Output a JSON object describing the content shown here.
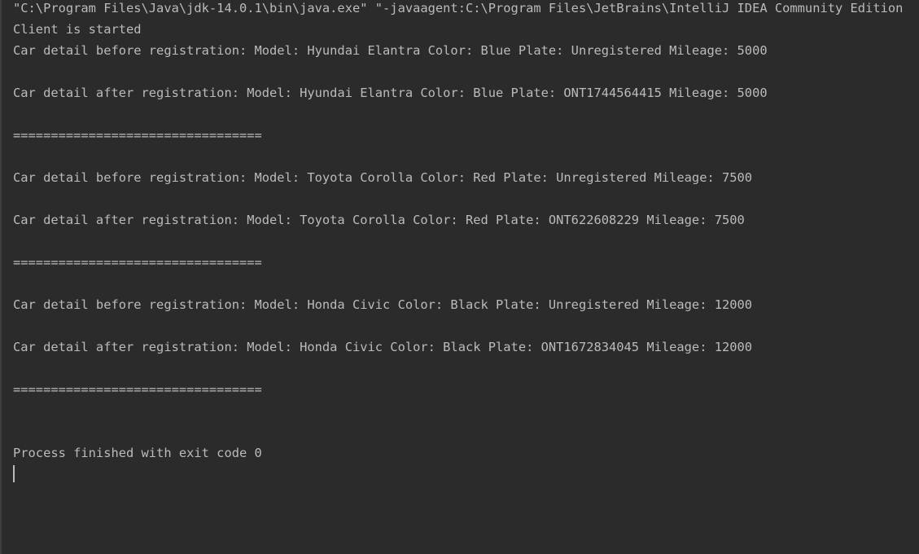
{
  "console": {
    "command": "\"C:\\Program Files\\Java\\jdk-14.0.1\\bin\\java.exe\" \"-javaagent:C:\\Program Files\\JetBrains\\IntelliJ IDEA Community Edition",
    "lines": [
      "Client is started",
      "Car detail before registration: Model: Hyundai Elantra Color: Blue Plate: Unregistered Mileage: 5000",
      "",
      "Car detail after registration: Model: Hyundai Elantra Color: Blue Plate: ONT1744564415 Mileage: 5000",
      "",
      "=================================",
      "",
      "Car detail before registration: Model: Toyota Corolla Color: Red Plate: Unregistered Mileage: 7500",
      "",
      "Car detail after registration: Model: Toyota Corolla Color: Red Plate: ONT622608229 Mileage: 7500",
      "",
      "=================================",
      "",
      "Car detail before registration: Model: Honda Civic Color: Black Plate: Unregistered Mileage: 12000",
      "",
      "Car detail after registration: Model: Honda Civic Color: Black Plate: ONT1672834045 Mileage: 12000",
      "",
      "=================================",
      "",
      "",
      "Process finished with exit code 0"
    ]
  },
  "colors": {
    "background": "#2b2b2b",
    "text": "#bbbbbb"
  }
}
